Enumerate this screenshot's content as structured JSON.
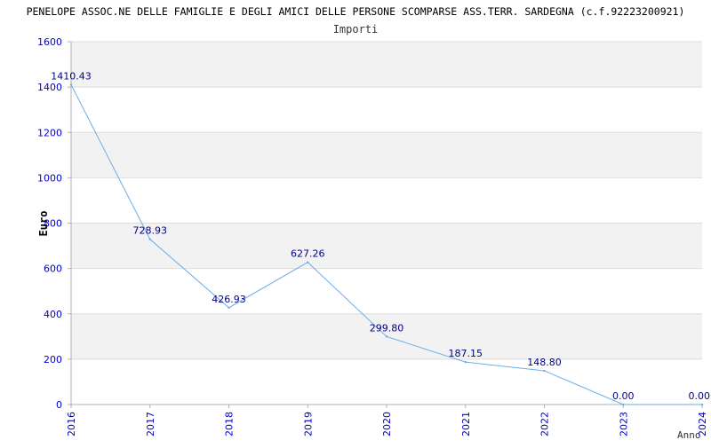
{
  "chart_data": {
    "type": "line",
    "title": "PENELOPE ASSOC.NE DELLE FAMIGLIE E DEGLI AMICI DELLE PERSONE SCOMPARSE ASS.TERR. SARDEGNA (c.f.92223200921)",
    "subtitle": "Importi",
    "xlabel": "Anno",
    "ylabel": "Euro",
    "categories": [
      "2016",
      "2017",
      "2018",
      "2019",
      "2020",
      "2021",
      "2022",
      "2023",
      "2024"
    ],
    "values": [
      1410.43,
      728.93,
      426.93,
      627.26,
      299.8,
      187.15,
      148.8,
      0,
      0
    ],
    "data_labels": [
      "1410.43",
      "728.93",
      "426.93",
      "627.26",
      "299.80",
      "187.15",
      "148.80",
      "0.00",
      "0.00"
    ],
    "ylim": [
      0,
      1600
    ],
    "yticks": [
      0,
      200,
      400,
      600,
      800,
      1000,
      1200,
      1400,
      1600
    ],
    "grid": true,
    "colors": {
      "line": "#6aaee8",
      "band": "#f2f2f2",
      "grid": "#dcdcdc",
      "axis": "#b0b0b0",
      "tick_text": "#0000cc",
      "label_text": "#000080",
      "title_text": "#000000"
    }
  }
}
